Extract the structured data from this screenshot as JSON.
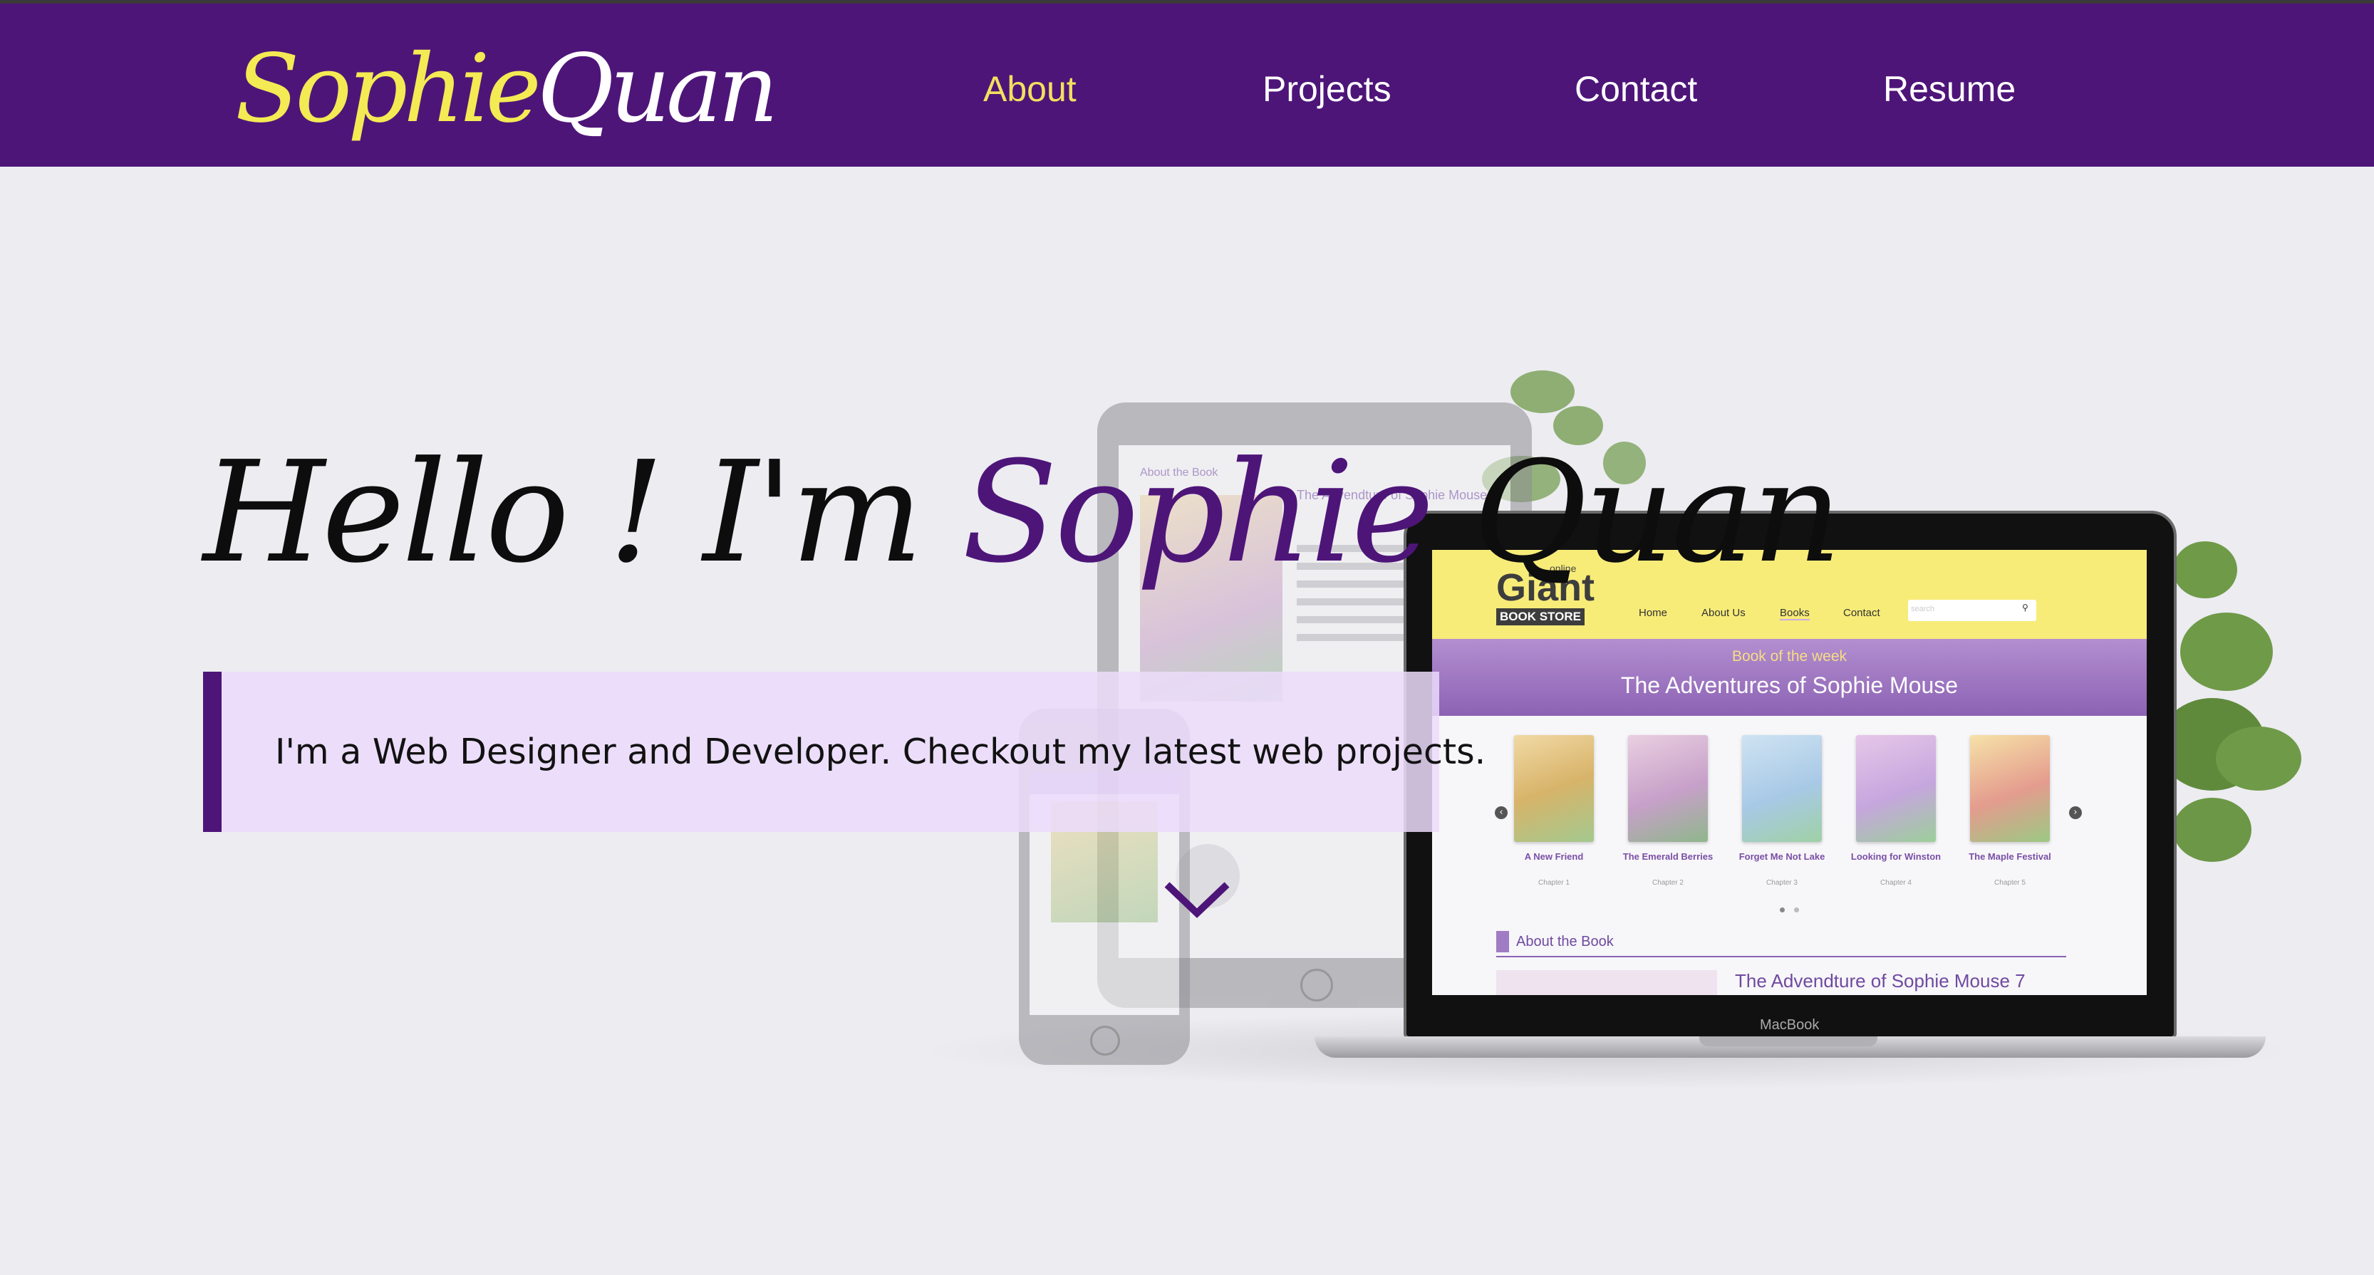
{
  "logo": {
    "first": "Sophie",
    "last": "Quan"
  },
  "nav": {
    "items": [
      {
        "label": "About",
        "active": true
      },
      {
        "label": "Projects",
        "active": false
      },
      {
        "label": "Contact",
        "active": false
      },
      {
        "label": "Resume",
        "active": false
      }
    ]
  },
  "hero": {
    "greeting": "Hello ! I'm ",
    "name_first": "Sophie",
    "name_last": "Quan",
    "tagline": "I'm a Web Designer and Developer. Checkout my latest web projects."
  },
  "showcase": {
    "device_label": "MacBook",
    "store_logo_top": "online",
    "store_logo_main": "Giant",
    "store_logo_badge": "BOOK STORE",
    "store_nav": [
      "Home",
      "About Us",
      "Books",
      "Contact"
    ],
    "search_placeholder": "search",
    "banner_small": "Book of the week",
    "banner_title": "The Adventures of Sophie Mouse",
    "books": [
      {
        "title": "A New Friend",
        "chapter": "Chapter 1"
      },
      {
        "title": "The Emerald Berries",
        "chapter": "Chapter 2"
      },
      {
        "title": "Forget Me Not Lake",
        "chapter": "Chapter 3"
      },
      {
        "title": "Looking for Winston",
        "chapter": "Chapter 4"
      },
      {
        "title": "The Maple Festival",
        "chapter": "Chapter 5"
      }
    ],
    "about_heading": "About the Book",
    "subtitle": "The Advendture of Sophie Mouse 7",
    "tablet_heading": "The Advendture of Sophie Mouse 7",
    "tablet_about": "About the Book"
  },
  "colors": {
    "brand_purple": "#4e1579",
    "nav_active": "#f2e05f",
    "logo_yellow": "#f4ea54",
    "tagline_bg": "#ecdcfb"
  }
}
